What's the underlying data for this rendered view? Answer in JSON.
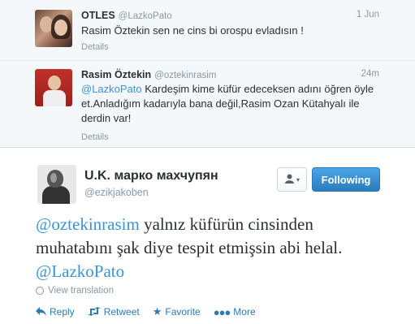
{
  "tweets": [
    {
      "name": "OTLES",
      "handle": "@LazkoPato",
      "time": "1 Jun",
      "text_plain": "Rasim Öztekin sen ne cins bi orospu evladısın !",
      "details": "Details"
    },
    {
      "name": "Rasim Öztekin",
      "handle": "@oztekinrasim",
      "time": "24m",
      "mention": "@LazkoPato",
      "text_plain": " Kardeşim kime küfür edeceksen adını öğren öyle et.Anladığım kadarıyla bana değil,Rasim Ozan Kütahyalı ile derdin var!",
      "details": "Details"
    }
  ],
  "main_tweet": {
    "name": "U.K. марко махчупян",
    "handle": "@ezikjakoben",
    "follow_label": "Following",
    "user_menu_icon": "user-dropdown-icon",
    "mention_start": "@oztekinrasim",
    "text_middle": " yalnız küfürün cinsinden muhatabını şak diye tespit etmişsin abi helal. ",
    "mention_end": "@LazkoPato",
    "translate": "View translation",
    "actions": {
      "reply": "Reply",
      "retweet": "Retweet",
      "favorite": "Favorite",
      "more": "More"
    }
  },
  "colors": {
    "link": "#3b94d9",
    "follow_button": "#2b7bb9",
    "muted": "#8899a6"
  }
}
